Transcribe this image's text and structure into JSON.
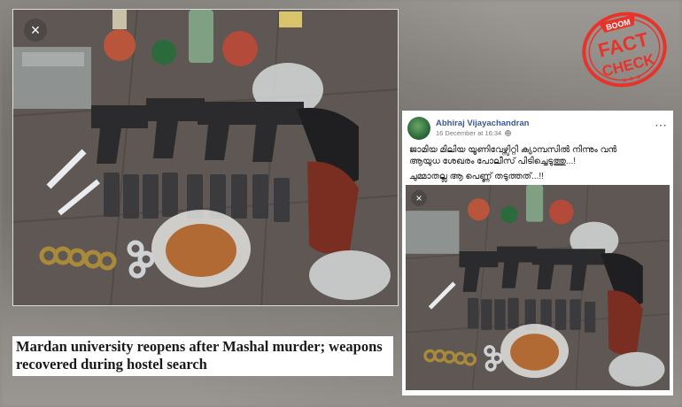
{
  "caption": {
    "line1": "Mardan university reopens after Mashal murder; weapons",
    "line2": "recovered during hostel search"
  },
  "post": {
    "author": "Abhiraj Vijayachandran",
    "timestamp": "16 December at 16:34",
    "more_icon": "⋯",
    "line1": "ജാമിയ മിലിയ യൂണിവേഴ്സിറ്റി ക്യാമ്പസിൽ നിന്നും വൻ",
    "line2": "ആയുധ ശേഖരം പോലീസ് പിടിച്ചെടുത്തു...!",
    "line3": "ചുമ്മാതല്ല ആ പെണ്ണ് തടുത്തത്...!!"
  },
  "stamp": {
    "top": "BOOM",
    "word1": "FACT",
    "word2": "CHECK",
    "color": "#e8332a"
  },
  "close_glyph": "×"
}
